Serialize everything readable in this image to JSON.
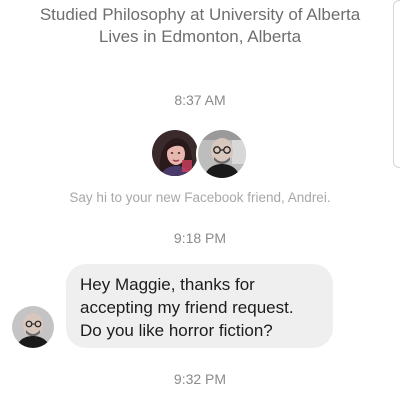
{
  "profile": {
    "education": "Studied Philosophy at University of Alberta",
    "location": "Lives in Edmonton, Alberta"
  },
  "timestamps": [
    "8:37 AM",
    "9:18 PM",
    "9:32 PM"
  ],
  "friend_notice": "Say hi to your new Facebook friend, Andrei.",
  "messages": [
    {
      "sender": "Andrei",
      "lines": [
        "Hey Maggie, thanks for",
        "accepting my friend request.",
        "Do you like horror fiction?"
      ]
    }
  ],
  "colors": {
    "bubble_background": "#efefef",
    "meta_text": "#8a8a8a",
    "profile_text": "#6e6e6e"
  }
}
